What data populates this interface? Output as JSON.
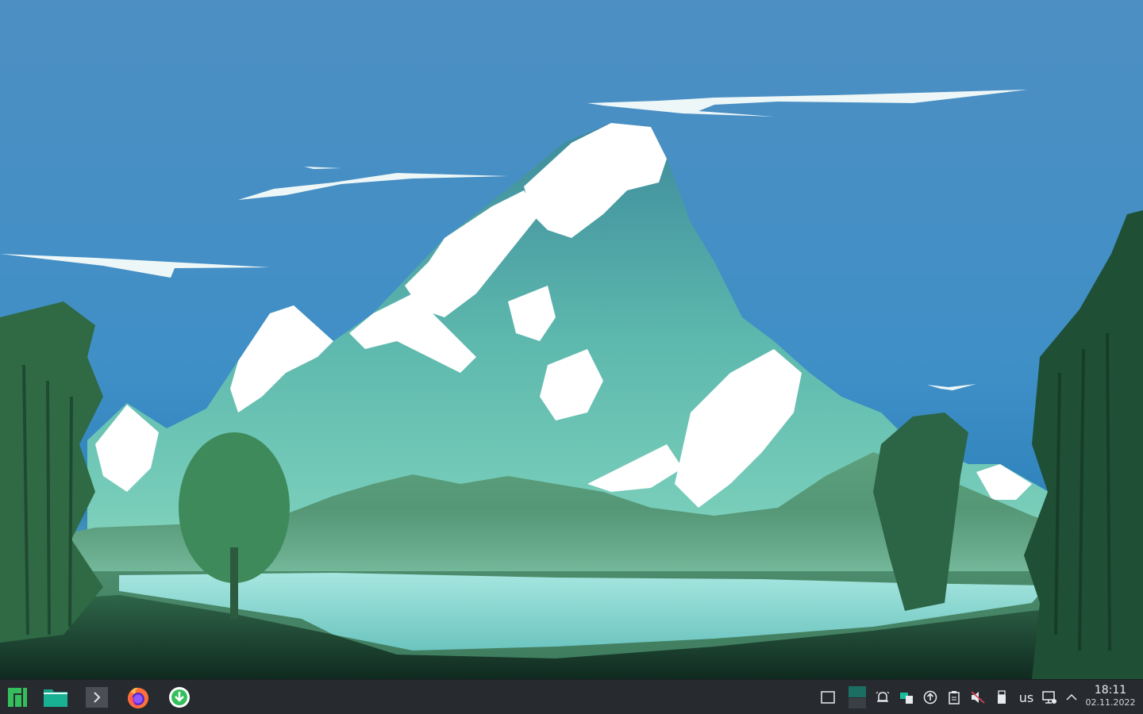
{
  "desktop": {
    "wallpaper": "mountain-lake-landscape"
  },
  "taskbar": {
    "launchers": [
      {
        "name": "application-menu",
        "icon": "manjaro-logo-icon"
      },
      {
        "name": "file-manager",
        "icon": "folder-icon"
      },
      {
        "name": "terminal",
        "icon": "terminal-icon"
      },
      {
        "name": "firefox",
        "icon": "firefox-icon"
      },
      {
        "name": "software-updater",
        "icon": "download-icon"
      }
    ],
    "tray": {
      "keyboard_layout": "us",
      "icons": [
        "show-desktop-icon",
        "virtual-desktop-pager",
        "notifications-icon",
        "kde-connect-icon",
        "updates-icon",
        "clipboard-icon",
        "volume-muted-icon",
        "usb-device-icon",
        "network-icon",
        "expand-tray-icon"
      ]
    },
    "clock": {
      "time": "18:11",
      "date": "02.11.2022"
    }
  },
  "colors": {
    "accent": "#1abc9c",
    "manjaro_green": "#35bf5c",
    "taskbar_bg": "#272b30"
  }
}
